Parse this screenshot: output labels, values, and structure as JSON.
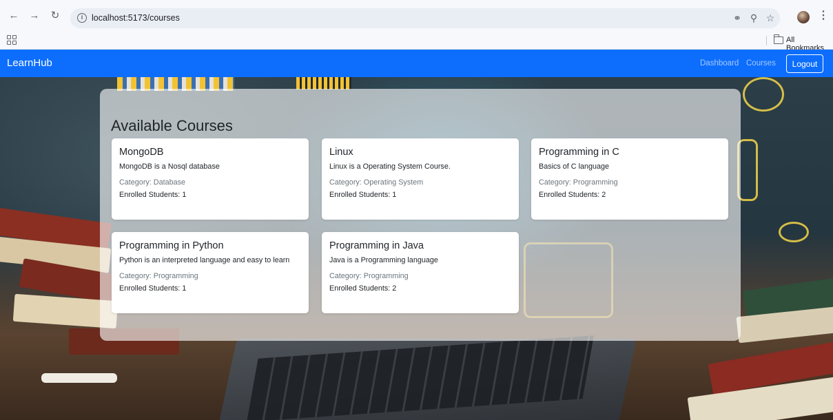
{
  "browser": {
    "url": "localhost:5173/courses",
    "bookmarks_label": "All Bookmarks"
  },
  "app": {
    "brand": "LearnHub",
    "nav": {
      "dashboard": "Dashboard",
      "courses": "Courses",
      "logout": "Logout"
    }
  },
  "colors": {
    "navbar": "#0d6efd",
    "card_bg": "#ffffff",
    "muted_text": "#6c757d"
  },
  "icons": [
    "back-arrow-icon",
    "forward-arrow-icon",
    "reload-icon",
    "info-icon",
    "password-key-icon",
    "zoom-icon",
    "star-icon",
    "avatar",
    "menu-dots-icon",
    "apps-grid-icon",
    "folder-icon"
  ],
  "page": {
    "title": "Available Courses",
    "courses": [
      {
        "title": "MongoDB",
        "description": "MongoDB is a Nosql database",
        "category": "Category: Database",
        "enrolled": "Enrolled Students: 1"
      },
      {
        "title": "Linux",
        "description": "Linux is a Operating System Course.",
        "category": "Category: Operating System",
        "enrolled": "Enrolled Students: 1"
      },
      {
        "title": "Programming in C",
        "description": "Basics of C language",
        "category": "Category: Programming",
        "enrolled": "Enrolled Students: 2"
      },
      {
        "title": "Programming in Python",
        "description": "Python is an interpreted language and easy to learn",
        "category": "Category: Programming",
        "enrolled": "Enrolled Students: 1"
      },
      {
        "title": "Programming in Java",
        "description": "Java is a Programming language",
        "category": "Category: Programming",
        "enrolled": "Enrolled Students: 2"
      }
    ]
  }
}
